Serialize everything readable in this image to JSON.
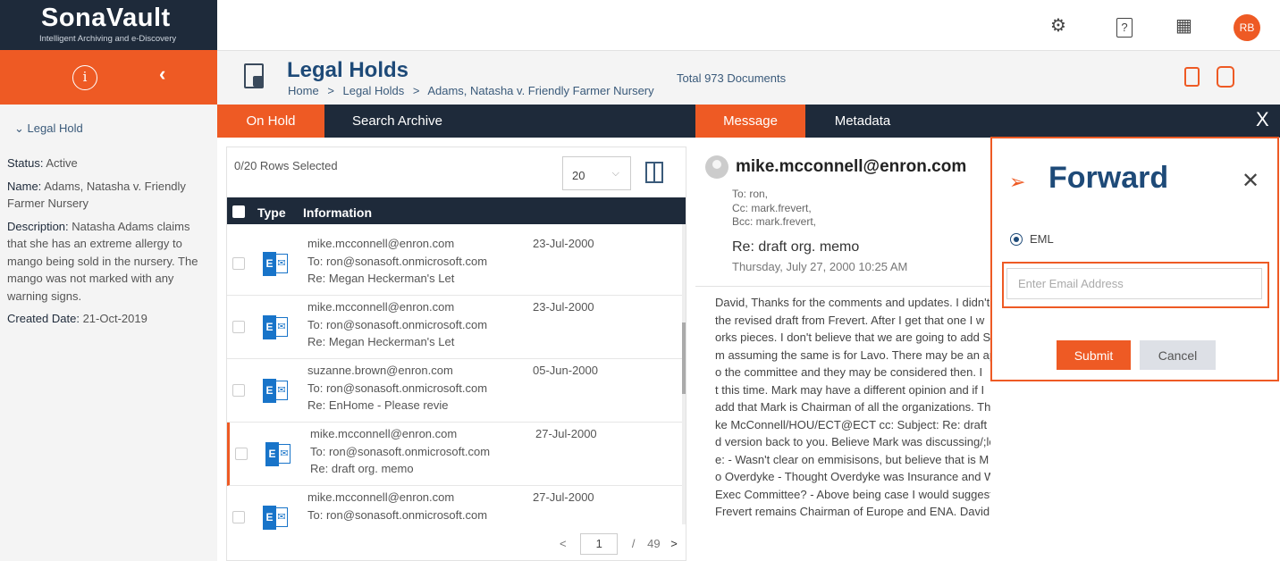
{
  "logo": {
    "name": "SonaVault",
    "tagline": "Intelligent Archiving and e-Discovery"
  },
  "user": {
    "initials": "RB"
  },
  "icons": {
    "settings": "gear-icon",
    "help": "help-icon",
    "apps": "grid-icon",
    "info": "info-icon",
    "collapse": "chevron-left-icon",
    "unlock": "unlock-icon",
    "database": "database-icon",
    "forward": "send-icon"
  },
  "colors": {
    "accent": "#ee5a24",
    "navy": "#1e2a3a",
    "title_blue": "#1e4a78",
    "exchange_blue": "#1874c9"
  },
  "sidebar": {
    "section_label": "Legal Hold",
    "status_label": "Status:",
    "status_value": "Active",
    "name_label": "Name:",
    "name_value": "Adams, Natasha v. Friendly Farmer Nursery",
    "description_label": "Description:",
    "description_value": "Natasha Adams claims that she has an extreme allergy to mango being sold in the nursery. The mango was not marked with any warning signs.",
    "created_label": "Created Date:",
    "created_value": "21-Oct-2019"
  },
  "header": {
    "title": "Legal Holds",
    "breadcrumb": [
      "Home",
      ">",
      "Legal Holds",
      ">",
      "Adams, Natasha v. Friendly Farmer Nursery"
    ],
    "total": "Total 973 Documents"
  },
  "tabs": {
    "left": [
      {
        "label": "On Hold",
        "active": true
      },
      {
        "label": "Search Archive",
        "active": false
      }
    ],
    "right": [
      {
        "label": "Message",
        "active": true
      },
      {
        "label": "Metadata",
        "active": false
      }
    ],
    "close": "X"
  },
  "list": {
    "rows_selected": "0/20 Rows Selected",
    "page_size": "20",
    "columns": [
      "Type",
      "Information"
    ],
    "rows": [
      {
        "from": "mike.mcconnell@enron.com",
        "to": "To: ron@sonasoft.onmicrosoft.com",
        "subject": "Re: Megan Heckerman's Let",
        "date": "23-Jul-2000",
        "selected": false
      },
      {
        "from": "mike.mcconnell@enron.com",
        "to": "To: ron@sonasoft.onmicrosoft.com",
        "subject": "Re: Megan Heckerman's Let",
        "date": "23-Jul-2000",
        "selected": false
      },
      {
        "from": "suzanne.brown@enron.com",
        "to": "To: ron@sonasoft.onmicrosoft.com",
        "subject": "Re: EnHome - Please revie",
        "date": "05-Jun-2000",
        "selected": false
      },
      {
        "from": "mike.mcconnell@enron.com",
        "to": "To: ron@sonasoft.onmicrosoft.com",
        "subject": "Re: draft org. memo",
        "date": "27-Jul-2000",
        "selected": true
      },
      {
        "from": "mike.mcconnell@enron.com",
        "to": "To: ron@sonasoft.onmicrosoft.com",
        "subject": "",
        "date": "27-Jul-2000",
        "selected": false
      }
    ],
    "pager": {
      "prev": "<",
      "current": "1",
      "separator": "/",
      "total": "49",
      "next": ">"
    }
  },
  "message": {
    "from": "mike.mcconnell@enron.com",
    "to": "To: ron,",
    "cc": "Cc:  mark.frevert,",
    "bcc": "Bcc:  mark.frevert,",
    "subject": "Re: draft org. memo",
    "date": "Thursday, July 27, 2000 10:25 AM",
    "body_lines": [
      "David, Thanks for the comments and updates. I didn't",
      "the revised draft from Frevert. After I get that one I w",
      "orks pieces. I don't believe that we are going to add S",
      "m assuming the same is for Lavo. There may be an ap",
      "o the committee and they may be considered then. I",
      "t this time. Mark may have a different opinion and if I",
      "add that Mark is Chairman of all the organizations. Th",
      "ke McConnell/HOU/ECT@ECT cc: Subject: Re: draft or",
      "d version back to you. Believe Mark was discussing/;lo",
      "e: - Wasn't clear on emmisisons, but believe that is M",
      "o Overdyke - Thought Overdyke was Insurance and W",
      "Exec Committee? - Above being case I would suggest",
      "Frevert remains Chairman of Europe and ENA. David"
    ]
  },
  "forward": {
    "title": "Forward",
    "close": "✕",
    "format_label": "EML",
    "email_placeholder": "Enter Email Address",
    "submit_label": "Submit",
    "cancel_label": "Cancel"
  }
}
